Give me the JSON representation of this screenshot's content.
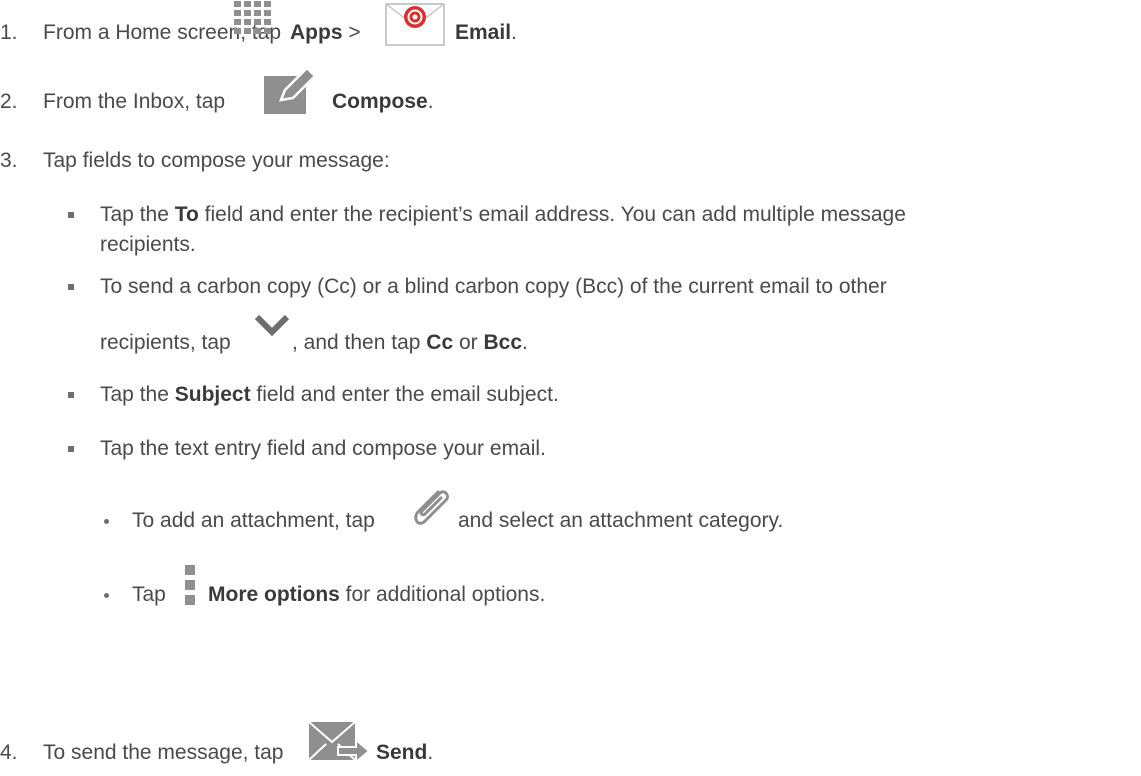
{
  "steps": [
    {
      "number": "1.",
      "pre": "From a Home screen, tap ",
      "apps_label": "Apps",
      "sep": " > ",
      "email_label": "Email",
      "end": "."
    },
    {
      "number": "2.",
      "pre": "From the Inbox, tap ",
      "compose_label": "Compose",
      "end": "."
    },
    {
      "number": "3.",
      "text": "Tap fields to compose your message:"
    },
    {
      "number": "4.",
      "pre": "To send the message, tap ",
      "send_label": "Send",
      "end": "."
    }
  ],
  "bullets": {
    "to": {
      "pre": "Tap the ",
      "bold": "To",
      "post": " field and enter the recipient’s email address. You can add multiple message",
      "cont": "recipients."
    },
    "cc": {
      "line1": "To send a carbon copy (Cc) or a blind carbon copy (Bcc) of the current email to other",
      "pre": "recipients, tap ",
      "mid": ", and then tap ",
      "cc_bold": "Cc",
      "or": " or ",
      "bcc_bold": "Bcc",
      "end": "."
    },
    "subject": {
      "pre": "Tap the ",
      "bold": "Subject",
      "post": " field and enter the email subject."
    },
    "body": {
      "text": "Tap the text entry field and compose your email."
    }
  },
  "subbullets": {
    "attach": {
      "pre": "To add an attachment, tap ",
      "post": " and select an attachment category."
    },
    "more": {
      "pre": "Tap ",
      "bold": "More options",
      "post": " for additional options."
    }
  },
  "icons": {
    "apps": "apps-grid-icon",
    "email": "email-icon",
    "compose": "compose-icon",
    "expand": "chevron-down-icon",
    "attach": "paperclip-icon",
    "more": "more-options-icon",
    "send": "send-icon"
  }
}
